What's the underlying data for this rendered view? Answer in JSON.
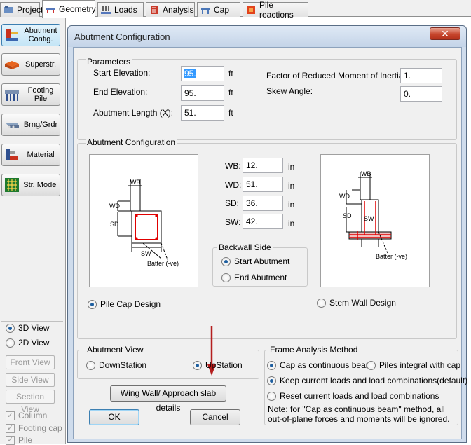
{
  "tabs": [
    {
      "label": "Project",
      "icon": "project-icon"
    },
    {
      "label": "Geometry",
      "icon": "geometry-icon",
      "active": true
    },
    {
      "label": "Loads",
      "icon": "loads-icon"
    },
    {
      "label": "Analysis",
      "icon": "analysis-icon"
    },
    {
      "label": "Cap",
      "icon": "cap-icon"
    },
    {
      "label": "Pile reactions",
      "icon": "pile-reactions-icon"
    }
  ],
  "sidebar": {
    "items": [
      {
        "label": "Abutment Config.",
        "icon": "abutment-icon",
        "active": true
      },
      {
        "label": "Superstr.",
        "icon": "superstructure-icon"
      },
      {
        "label": "Footing Pile",
        "icon": "footing-pile-icon"
      },
      {
        "label": "Brng/Grdr",
        "icon": "bearing-girder-icon"
      },
      {
        "label": "Material",
        "icon": "material-icon"
      },
      {
        "label": "Str. Model",
        "icon": "structural-model-icon"
      }
    ],
    "view_3d": "3D View",
    "view_2d": "2D View",
    "front_view": "Front View",
    "side_view": "Side View",
    "section_view": "Section View",
    "column": "Column",
    "footing_cap": "Footing cap",
    "pile": "Pile"
  },
  "dialog": {
    "title": "Abutment Configuration",
    "close_glyph": "✕",
    "parameters": {
      "group_label": "Parameters",
      "start_elevation_label": "Start Elevation:",
      "start_elevation_value": "95.",
      "end_elevation_label": "End Elevation:",
      "end_elevation_value": "95.",
      "abutment_length_label": "Abutment Length (X):",
      "abutment_length_value": "51.",
      "unit_ft": "ft",
      "factor_label": "Factor of Reduced Moment of Inertia:",
      "factor_value": "1.",
      "skew_label": "Skew Angle:",
      "skew_value": "0."
    },
    "config": {
      "group_label": "Abutment Configuration",
      "wb_label": "WB:",
      "wb_value": "12.",
      "wd_label": "WD:",
      "wd_value": "51.",
      "sd_label": "SD:",
      "sd_value": "36.",
      "sw_label": "SW:",
      "sw_value": "42.",
      "unit_in": "in",
      "backwall_label": "Backwall Side",
      "start_abutment": "Start Abutment",
      "end_abutment": "End Abutment",
      "pile_cap_design": "Pile Cap Design",
      "stem_wall_design": "Stem Wall Design",
      "diagram_wb": "WB",
      "diagram_wd": "WD",
      "diagram_sd": "SD",
      "diagram_sw": "SW",
      "diagram_batter": "Batter (-ve)"
    },
    "abutment_view": {
      "group_label": "Abutment View",
      "downstation": "DownStation",
      "upstation": "UpStation"
    },
    "frame_analysis": {
      "group_label": "Frame Analysis Method",
      "cap_continuous": "Cap as continuous beam",
      "piles_integral": "Piles integral with cap",
      "keep_loads": "Keep current loads and load combinations(default)",
      "reset_loads": "Reset current loads and load combinations",
      "note": "Note: for \"Cap as continuous beam\" method, all out-of-plane forces and moments will be ignored."
    },
    "wing_wall_button": "Wing Wall/ Approach slab details",
    "ok_button": "OK",
    "cancel_button": "Cancel"
  },
  "colors": {
    "annotation_arrow": "#b41e1e",
    "rebar": "#e00000",
    "accent": "#3c7fb1"
  }
}
